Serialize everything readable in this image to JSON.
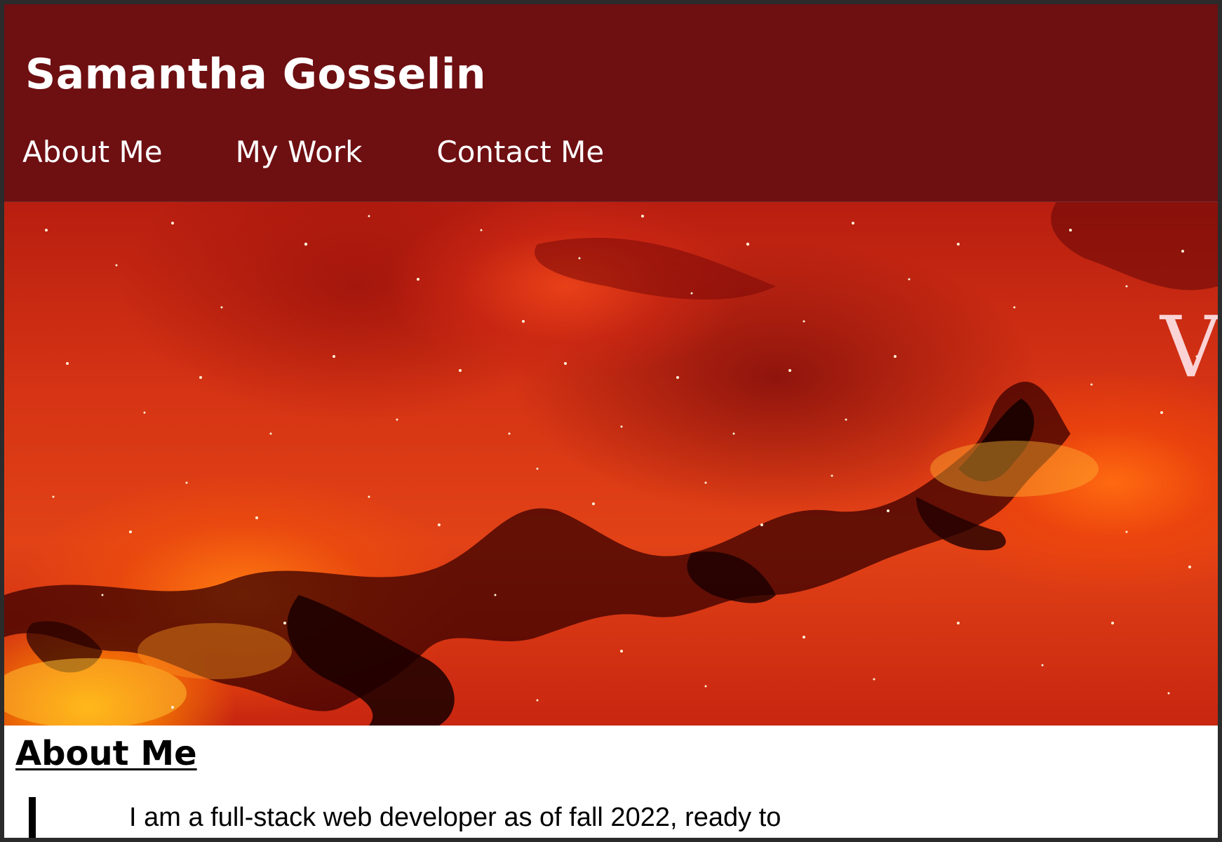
{
  "header": {
    "site_title": "Samantha Gosselin",
    "nav": [
      {
        "label": "About Me"
      },
      {
        "label": "My Work"
      },
      {
        "label": "Contact Me"
      }
    ],
    "background_color": "#6e0f12"
  },
  "hero": {
    "image_description": "red-orange nebula with stars",
    "overlay_text": "V",
    "dominant_colors": [
      "#c82610",
      "#ff7a10",
      "#1a0000"
    ]
  },
  "about": {
    "heading": "About Me",
    "intro_text": "I am a full-stack web developer as of fall 2022, ready to"
  }
}
